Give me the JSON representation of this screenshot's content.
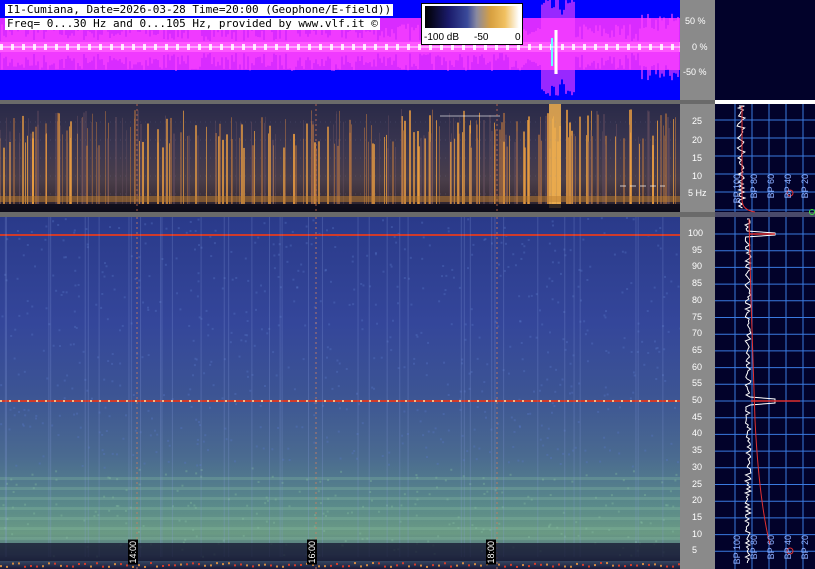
{
  "header": {
    "line1": "I1-Cumiana, Date=2026-03-28 Time=20:00 (Geophone/E-field))",
    "line2": "Freq= 0...30 Hz and 0...105 Hz, provided by www.vlf.it ©"
  },
  "colorbar": {
    "labels": [
      "-100 dB",
      "-50",
      "0"
    ]
  },
  "waveform_axis": {
    "labels": [
      "50 %",
      "0 %",
      "-50 %"
    ]
  },
  "lf_axis": {
    "labels": [
      "25",
      "20",
      "15",
      "10",
      "5 Hz"
    ]
  },
  "hf_axis": {
    "labels": [
      "100",
      "95",
      "90",
      "85",
      "80",
      "75",
      "70",
      "65",
      "60",
      "55",
      "50",
      "45",
      "40",
      "35",
      "30",
      "25",
      "20",
      "15",
      "10",
      "5"
    ]
  },
  "time_markers": [
    "14:00",
    "16:00",
    "18:00"
  ],
  "bp_labels_top": [
    "BP 100",
    "BP 80",
    "BP 60",
    "BP 40",
    "BP 20"
  ],
  "bp_labels_bottom": [
    "BP 100",
    "BP 80",
    "BP 60",
    "BP 40",
    "BP 20"
  ],
  "colors": {
    "waveform_bg": "#0000ff",
    "waveform_trace": "#ff33ff",
    "axis_gray": "#8a8a8a",
    "panel_bg": "#0a0a2e",
    "grid_blue": "#3a7adf",
    "marker_red": "#d03a2a"
  }
}
